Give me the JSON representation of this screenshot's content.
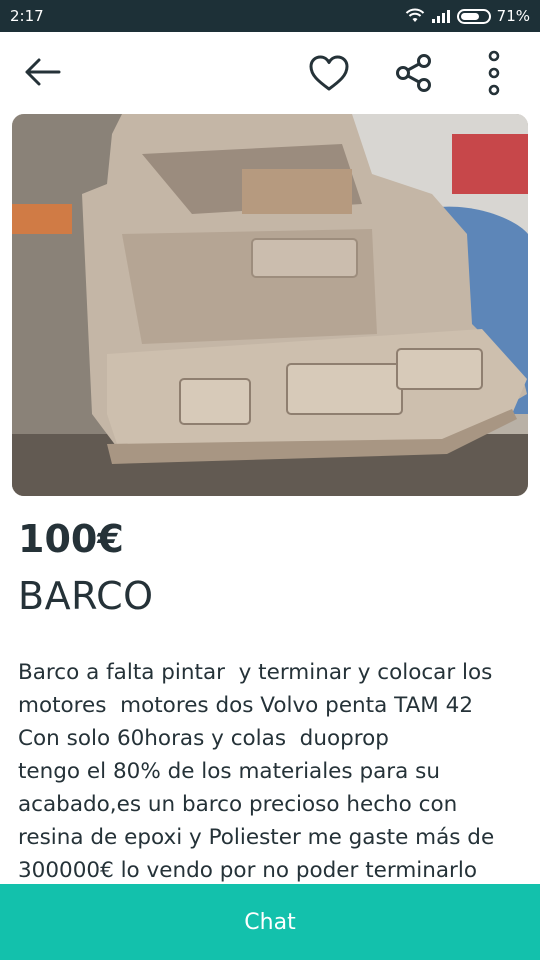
{
  "status_bar": {
    "time": "2:17",
    "battery": "71%",
    "battery_level": 0.71
  },
  "toolbar": {
    "back_icon": "arrow-left-icon",
    "favorite_icon": "heart-outline-icon",
    "share_icon": "share-icon",
    "more_icon": "more-vertical-icon"
  },
  "gallery": {
    "image_count": 4,
    "active_index": 0
  },
  "product": {
    "price": "100€",
    "title": "BARCO",
    "description_lines": [
      "Barco a falta pintar  y terminar y colocar los",
      "motores  motores dos Volvo penta TAM 42",
      "Con solo 60horas y colas  duoprop",
      "tengo el 80% de los materiales para su",
      "acabado,es un barco precioso hecho con",
      "resina de epoxi y Poliester me gaste más de",
      "300000€ lo vendo por no poder terminarlo"
    ]
  },
  "chat_button": {
    "label": "Chat"
  },
  "colors": {
    "accent": "#13c1ac",
    "status_bar": "#1d3037",
    "text": "#253238"
  }
}
